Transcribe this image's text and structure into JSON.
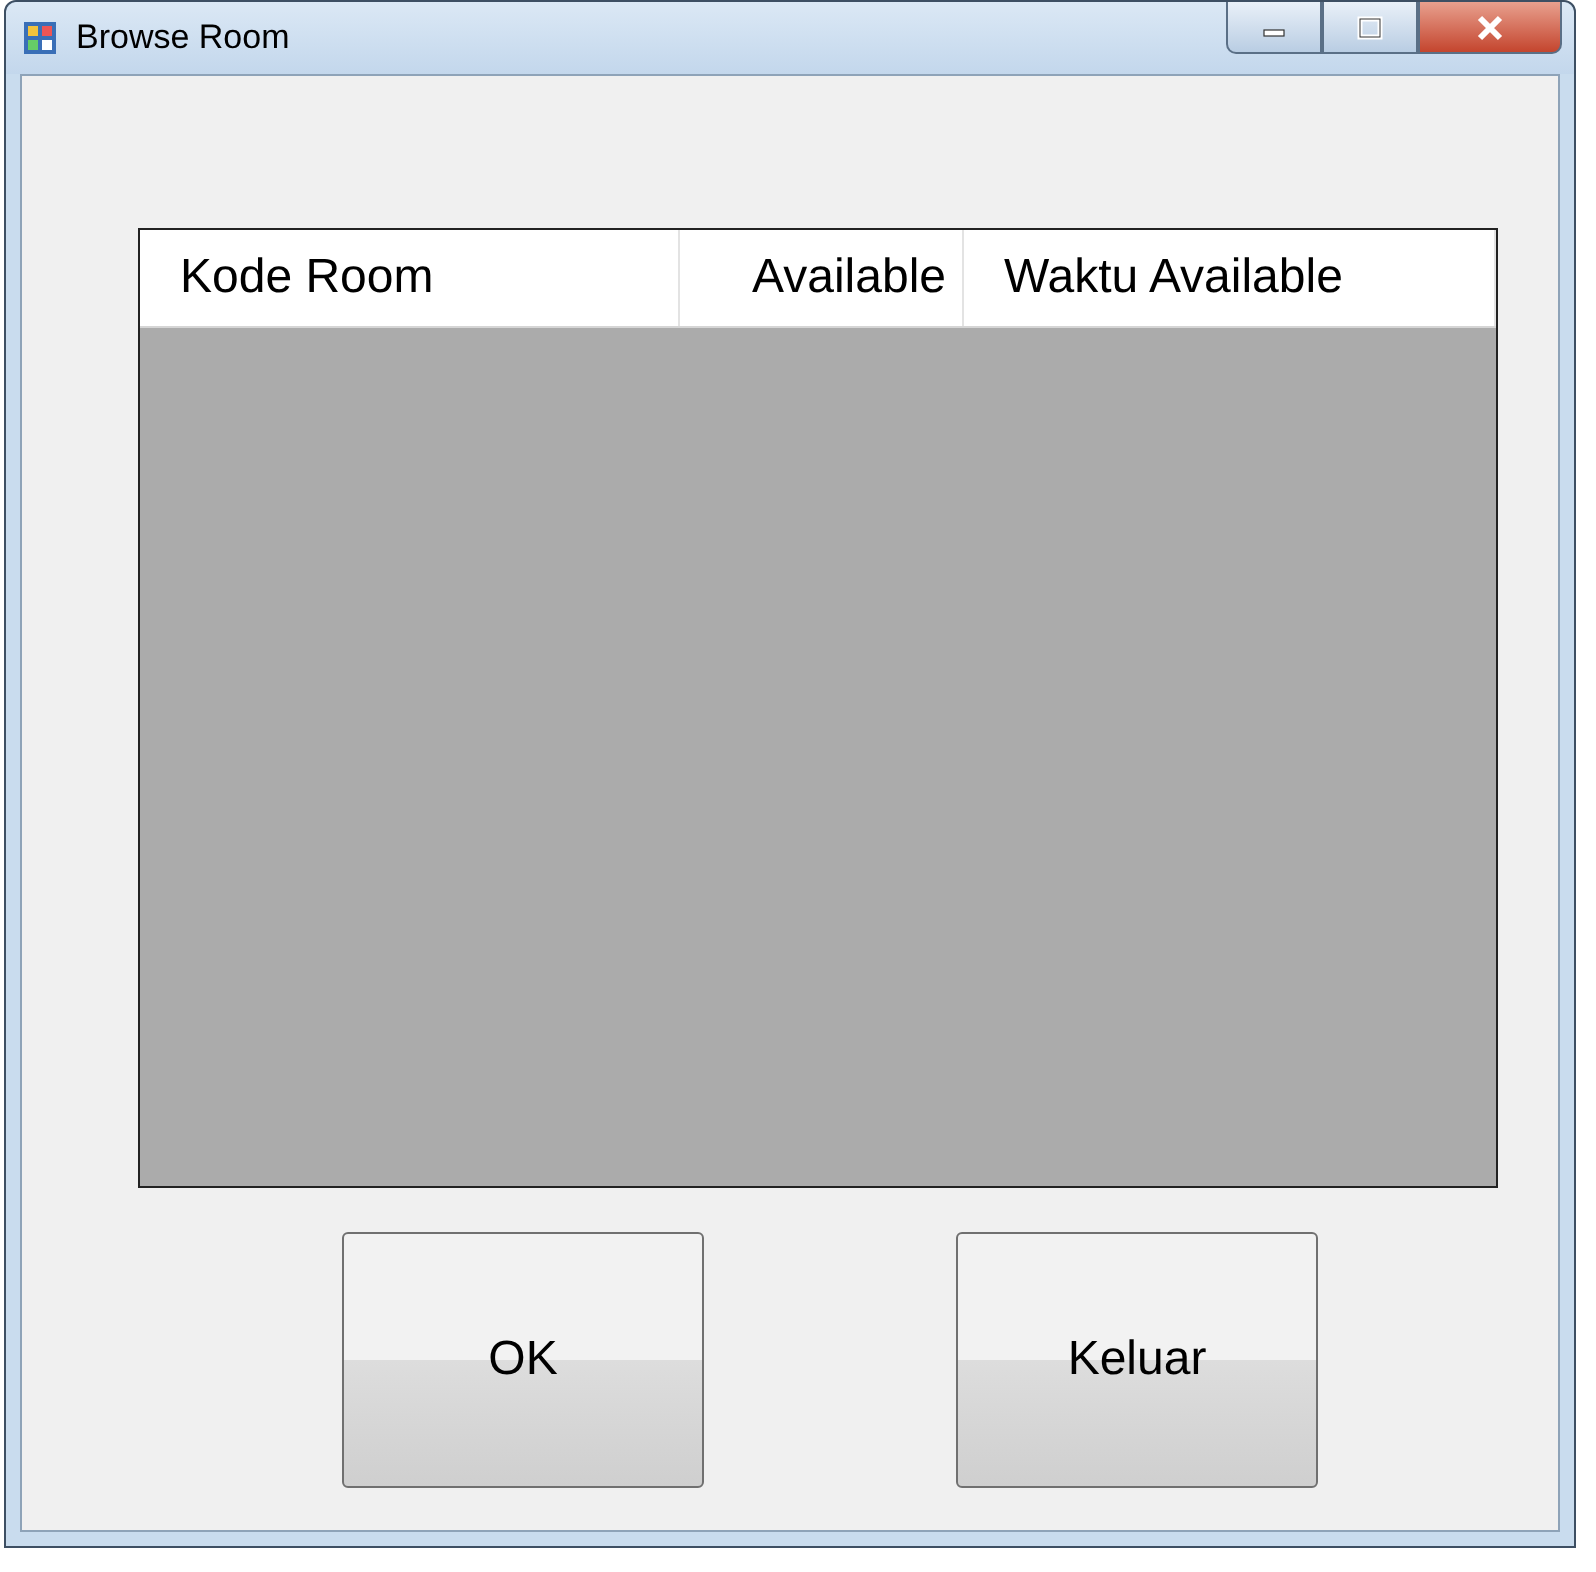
{
  "window": {
    "title": "Browse Room"
  },
  "table": {
    "columns": [
      "Kode Room",
      "Available",
      "Waktu Available"
    ]
  },
  "buttons": [
    {
      "label": "OK"
    },
    {
      "label": "Keluar"
    }
  ]
}
